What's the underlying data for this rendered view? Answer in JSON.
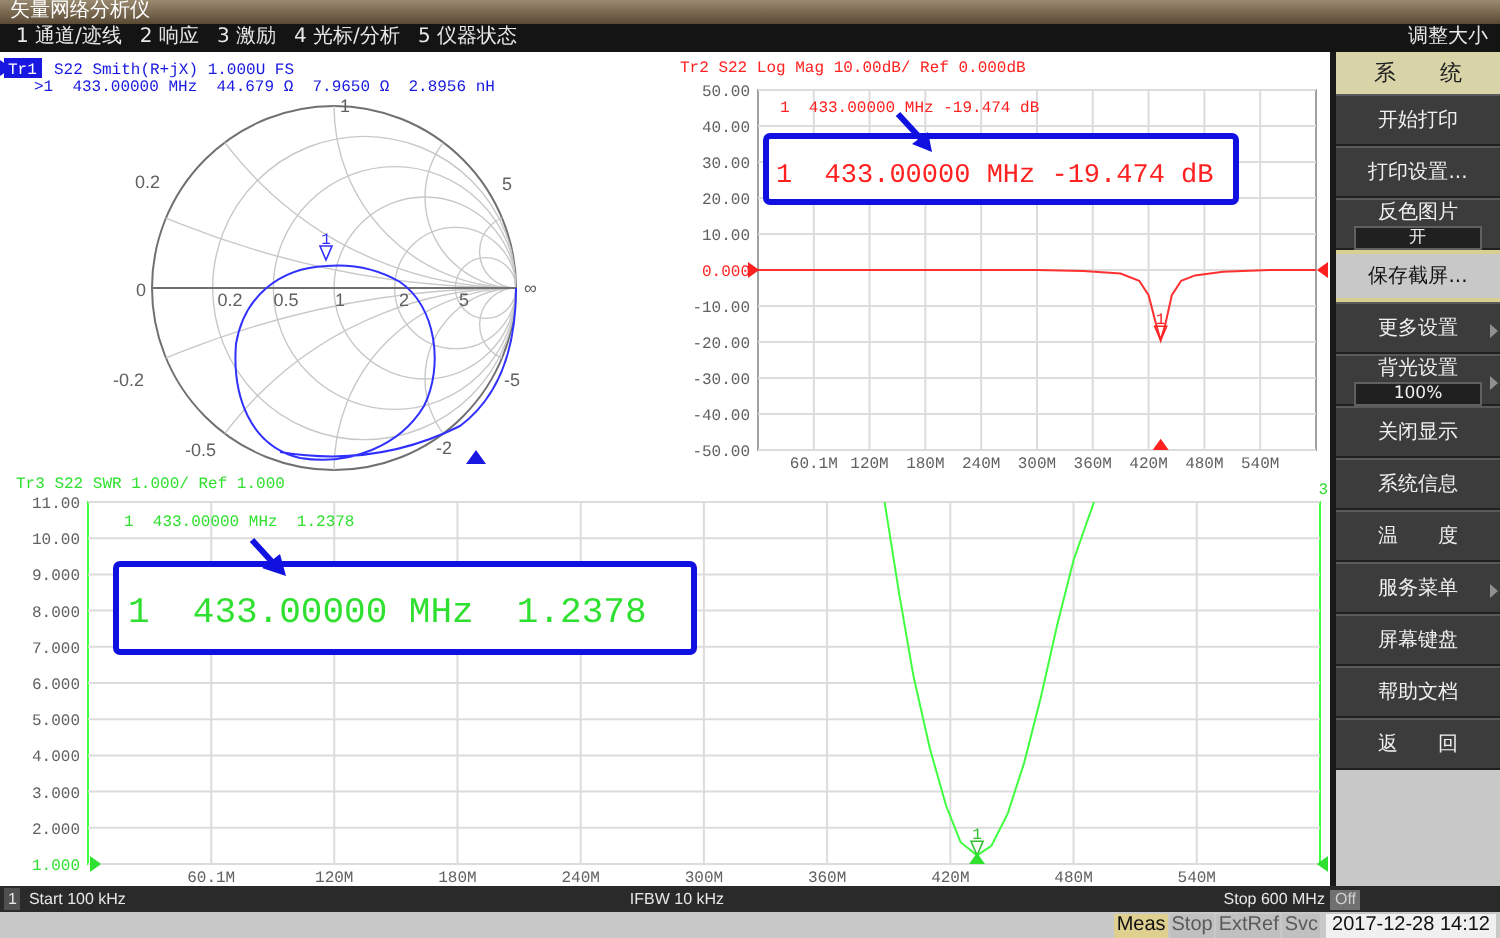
{
  "window": {
    "title": "矢量网络分析仪",
    "resize_label": "调整大小"
  },
  "menu": [
    "1 通道/迹线",
    "2 响应",
    "3 激励",
    "4 光标/分析",
    "5 仪器状态"
  ],
  "smith": {
    "trace": {
      "label": "Tr1",
      "selected": true
    },
    "title": "S22 Smith(R+jX) 1.000U FS",
    "marker_readout": ">1  433.00000 MHz  44.679 Ω  7.9650 Ω  2.8956 nH",
    "marker_label": "1",
    "grid_labels": [
      "1",
      "0.2",
      "5",
      "0",
      "0.2",
      "0.5",
      "1",
      "2",
      "5",
      "∞",
      "-0.2",
      "-5",
      "-0.5",
      "-2"
    ]
  },
  "logmag": {
    "title": "Tr2 S22 Log Mag 10.00dB/ Ref 0.000dB",
    "marker_readout": "1  433.00000 MHz -19.474 dB",
    "callout": "1  433.00000 MHz -19.474 dB",
    "chart_data": {
      "type": "line",
      "xlim": [
        0.1,
        600
      ],
      "ylim": [
        -50,
        50
      ],
      "xticks": [
        {
          "value": 60.1,
          "label": "60.1M"
        },
        {
          "value": 120,
          "label": "120M"
        },
        {
          "value": 180,
          "label": "180M"
        },
        {
          "value": 240,
          "label": "240M"
        },
        {
          "value": 300,
          "label": "300M"
        },
        {
          "value": 360,
          "label": "360M"
        },
        {
          "value": 420,
          "label": "420M"
        },
        {
          "value": 480,
          "label": "480M"
        },
        {
          "value": 540,
          "label": "540M"
        }
      ],
      "yticks": [
        {
          "value": 50,
          "label": "50.00"
        },
        {
          "value": 40,
          "label": "40.00"
        },
        {
          "value": 30,
          "label": "30.00"
        },
        {
          "value": 20,
          "label": "20.00"
        },
        {
          "value": 10,
          "label": "10.00"
        },
        {
          "value": 0,
          "label": "0.000"
        },
        {
          "value": -10,
          "label": "-10.00"
        },
        {
          "value": -20,
          "label": "-20.00"
        },
        {
          "value": -30,
          "label": "-30.00"
        },
        {
          "value": -40,
          "label": "-40.00"
        },
        {
          "value": -50,
          "label": "-50.00"
        }
      ],
      "x": [
        0.1,
        100,
        200,
        300,
        350,
        390,
        410,
        420,
        428,
        433,
        438,
        445,
        455,
        470,
        500,
        550,
        600
      ],
      "grid": true,
      "series": [
        {
          "color": "#ff3030",
          "values": [
            0,
            0,
            0,
            0,
            -0.3,
            -1,
            -3,
            -7,
            -15,
            -19.5,
            -15,
            -7,
            -3,
            -1.5,
            -0.5,
            0,
            0
          ]
        }
      ]
    },
    "marker_label": "1"
  },
  "swr": {
    "title": "Tr3 S22 SWR 1.000/ Ref 1.000",
    "trace_number": "3",
    "marker_readout": "1  433.00000 MHz  1.2378",
    "callout": "1  433.00000 MHz  1.2378",
    "chart_data": {
      "type": "line",
      "xlim": [
        0.1,
        600
      ],
      "ylim": [
        1,
        11
      ],
      "xticks": [
        {
          "value": 60.1,
          "label": "60.1M"
        },
        {
          "value": 120,
          "label": "120M"
        },
        {
          "value": 180,
          "label": "180M"
        },
        {
          "value": 240,
          "label": "240M"
        },
        {
          "value": 300,
          "label": "300M"
        },
        {
          "value": 360,
          "label": "360M"
        },
        {
          "value": 420,
          "label": "420M"
        },
        {
          "value": 480,
          "label": "480M"
        },
        {
          "value": 540,
          "label": "540M"
        }
      ],
      "yticks": [
        {
          "value": 11,
          "label": "11.00"
        },
        {
          "value": 10,
          "label": "10.00"
        },
        {
          "value": 9,
          "label": "9.000"
        },
        {
          "value": 8,
          "label": "8.000"
        },
        {
          "value": 7,
          "label": "7.000"
        },
        {
          "value": 6,
          "label": "6.000"
        },
        {
          "value": 5,
          "label": "5.000"
        },
        {
          "value": 4,
          "label": "4.000"
        },
        {
          "value": 3,
          "label": "3.000"
        },
        {
          "value": 2,
          "label": "2.000"
        },
        {
          "value": 1,
          "label": "1.000"
        }
      ],
      "x": [
        388,
        395,
        402,
        410,
        418,
        425,
        433,
        440,
        448,
        456,
        464,
        472,
        480,
        490
      ],
      "grid": true,
      "series": [
        {
          "color": "#40ff40",
          "values": [
            11,
            8.5,
            6.2,
            4.2,
            2.6,
            1.6,
            1.24,
            1.5,
            2.4,
            3.8,
            5.6,
            7.6,
            9.4,
            11
          ]
        }
      ]
    },
    "marker_label": "1"
  },
  "softkeys": [
    {
      "label": "系　　统",
      "kind": "header"
    },
    {
      "label": "开始打印",
      "kind": "button",
      "selected": false
    },
    {
      "label": "打印设置...",
      "kind": "button",
      "selected": false
    },
    {
      "label": "反色图片",
      "kind": "value",
      "value": "开",
      "selected": false
    },
    {
      "label": "保存截屏...",
      "kind": "button",
      "selected": true
    },
    {
      "label": "更多设置",
      "kind": "submenu",
      "selected": false
    },
    {
      "label": "背光设置",
      "kind": "value",
      "value": "100%",
      "submenu": true,
      "selected": false
    },
    {
      "label": "关闭显示",
      "kind": "button",
      "selected": false
    },
    {
      "label": "系统信息",
      "kind": "button",
      "selected": false
    },
    {
      "label": "温　　度",
      "kind": "button",
      "selected": false
    },
    {
      "label": "服务菜单",
      "kind": "submenu",
      "selected": false
    },
    {
      "label": "屏幕键盘",
      "kind": "button",
      "selected": false
    },
    {
      "label": "帮助文档",
      "kind": "button",
      "selected": false
    },
    {
      "label": "返　　回",
      "kind": "button",
      "selected": false
    }
  ],
  "status_bar": {
    "channel": "1",
    "start": "Start 100 kHz",
    "ifbw": "IFBW 10 kHz",
    "stop": "Stop 600 MHz",
    "off": "Off"
  },
  "indicators": [
    {
      "label": "Meas",
      "on": true
    },
    {
      "label": "Stop",
      "on": false
    },
    {
      "label": "ExtRef",
      "on": false
    },
    {
      "label": "Svc",
      "on": false
    }
  ],
  "datetime": "2017-12-28 14:12"
}
